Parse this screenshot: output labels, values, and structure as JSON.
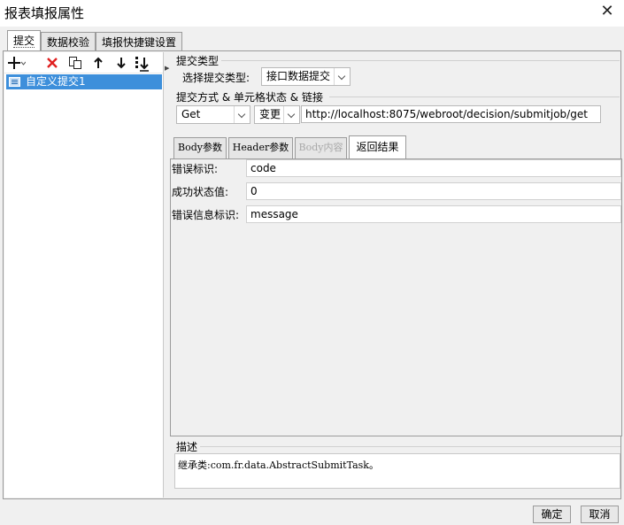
{
  "window": {
    "title": "报表填报属性"
  },
  "top_tabs": [
    "提交",
    "数据校验",
    "填报快捷键设置"
  ],
  "toolbar": {
    "add_icon": "plus-icon",
    "delete_icon": "red-x-icon",
    "copy_icon": "copy-icon",
    "up_icon": "arrow-up-icon",
    "down_icon": "arrow-down-icon",
    "bottom_icon": "move-to-bottom-icon"
  },
  "tree": {
    "items": [
      {
        "label": "自定义提交1"
      }
    ]
  },
  "submit_type": {
    "legend": "提交类型",
    "select_label": "选择提交类型:",
    "select_value": "接口数据提交"
  },
  "submit_method": {
    "legend": "提交方式 & 单元格状态 & 链接",
    "method_value": "Get",
    "state_value": "变更",
    "url_value": "http://localhost:8075/webroot/decision/submitjob/get"
  },
  "sub_tabs": [
    {
      "label": "Body参数",
      "state": "normal"
    },
    {
      "label": "Header参数",
      "state": "normal"
    },
    {
      "label": "Body内容",
      "state": "disabled"
    },
    {
      "label": "返回结果",
      "state": "active"
    }
  ],
  "result_fields": [
    {
      "label": "错误标识:",
      "value": "code"
    },
    {
      "label": "成功状态值:",
      "value": "0"
    },
    {
      "label": "错误信息标识:",
      "value": "message"
    }
  ],
  "description": {
    "legend": "描述",
    "text": "继承类:com.fr.data.AbstractSubmitTask。"
  },
  "footer": {
    "ok_label": "确定",
    "cancel_label": "取消"
  },
  "colors": {
    "selection": "#3d8fdb",
    "delete_red": "#e02020"
  }
}
